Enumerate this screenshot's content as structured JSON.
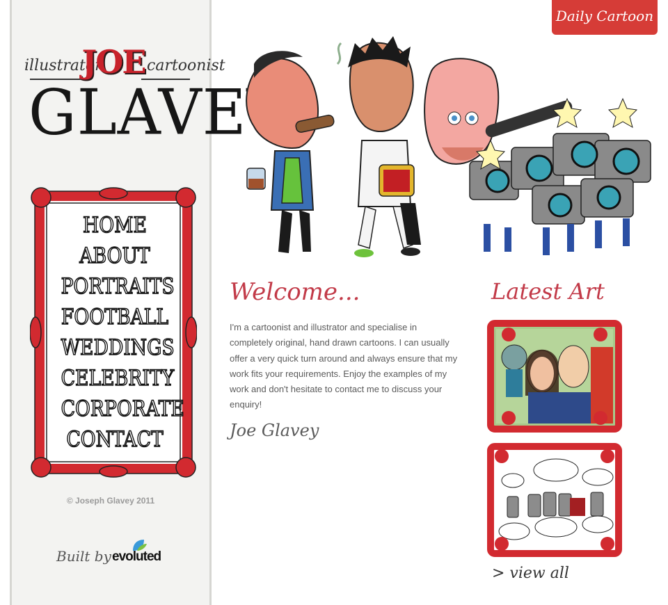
{
  "logo": {
    "left_word": "illustrator",
    "right_word": "cartoonist",
    "first_name": "JOE",
    "last_name": "GLAVEY"
  },
  "nav": {
    "items": [
      {
        "label": "HOME"
      },
      {
        "label": "ABOUT"
      },
      {
        "label": "PORTRAITS"
      },
      {
        "label": "FOOTBALL"
      },
      {
        "label": "WEDDINGS"
      },
      {
        "label": "CELEBRITY"
      },
      {
        "label": "CORPORATE"
      },
      {
        "label": "CONTACT"
      }
    ]
  },
  "footer": {
    "copyright": "© Joseph Glavey 2011",
    "built_by": "Built by",
    "builder": "evoluted"
  },
  "header": {
    "daily_cartoon": "Daily Cartoon ›"
  },
  "welcome": {
    "title": "Welcome...",
    "body": "I'm a cartoonist and illustrator and specialise in completely original, hand drawn cartoons. I can usually offer a very quick turn around and always ensure that my work fits your requirements. Enjoy the examples of my work and don't hesitate to contact me to discuss your enquiry!",
    "signature": "Joe Glavey"
  },
  "latest_art": {
    "title": "Latest Art",
    "view_all": "> view all"
  },
  "colors": {
    "accent_red": "#c23a48",
    "button_red": "#d63c37",
    "frame_red": "#d22a30",
    "sidebar_bg": "#f3f3f1"
  }
}
